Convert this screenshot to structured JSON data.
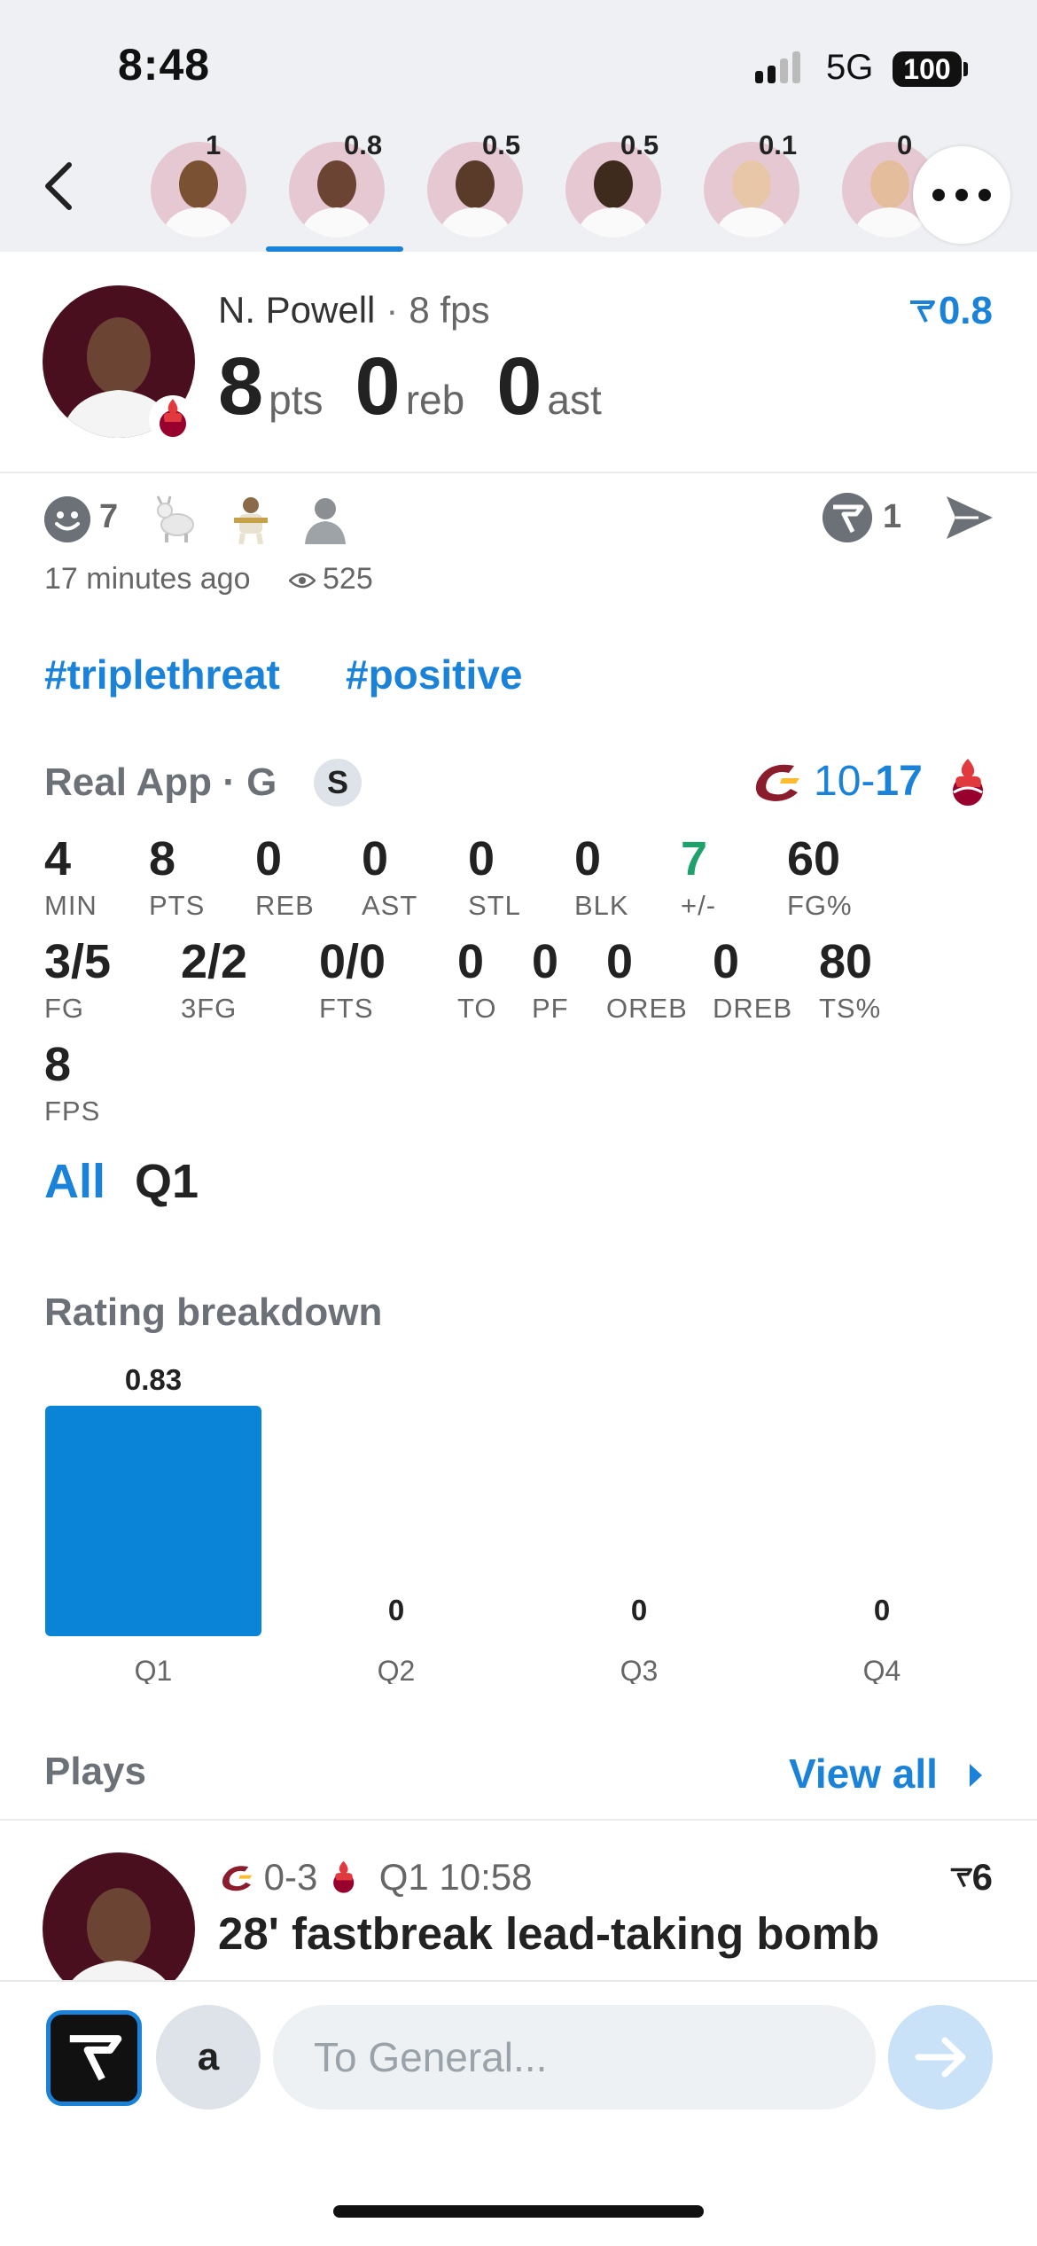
{
  "status_bar": {
    "time": "8:48",
    "network": "5G",
    "battery": "100"
  },
  "players_strip": [
    {
      "rating": "1"
    },
    {
      "rating": "0.8"
    },
    {
      "rating": "0.5"
    },
    {
      "rating": "0.5"
    },
    {
      "rating": "0.1"
    },
    {
      "rating": "0"
    }
  ],
  "player": {
    "name": "N. Powell",
    "fps": "8 fps",
    "rating": "0.8",
    "pts": "8",
    "pts_unit": "pts",
    "reb": "0",
    "reb_unit": "reb",
    "ast": "0",
    "ast_unit": "ast"
  },
  "reactions": {
    "count": "7",
    "v_count": "1",
    "time_ago": "17 minutes ago",
    "views": "525"
  },
  "hashtags": [
    "#triplethreat",
    "#positive"
  ],
  "game": {
    "app_line": "Real App · G",
    "badge": "S",
    "score_away": "10",
    "score_dash": "-",
    "score_home": "17",
    "colors": {
      "cavs": "#8b1c2c",
      "heat": "#98002e",
      "accent": "#1a82d8",
      "positive": "#20a06a"
    }
  },
  "stats_row1": [
    {
      "value": "4",
      "label": "MIN"
    },
    {
      "value": "8",
      "label": "PTS"
    },
    {
      "value": "0",
      "label": "REB"
    },
    {
      "value": "0",
      "label": "AST"
    },
    {
      "value": "0",
      "label": "STL"
    },
    {
      "value": "0",
      "label": "BLK"
    },
    {
      "value": "7",
      "label": "+/-"
    },
    {
      "value": "60",
      "label": "FG%"
    }
  ],
  "stats_row2": [
    {
      "value": "3/5",
      "label": "FG"
    },
    {
      "value": "2/2",
      "label": "3FG"
    },
    {
      "value": "0/0",
      "label": "FTS"
    },
    {
      "value": "0",
      "label": "TO"
    },
    {
      "value": "0",
      "label": "PF"
    },
    {
      "value": "0",
      "label": "OREB"
    },
    {
      "value": "0",
      "label": "DREB"
    },
    {
      "value": "80",
      "label": "TS%"
    }
  ],
  "stats_row3": [
    {
      "value": "8",
      "label": "FPS"
    }
  ],
  "filters": {
    "all": "All",
    "q1": "Q1"
  },
  "rating_breakdown": {
    "title": "Rating breakdown"
  },
  "chart_data": {
    "type": "bar",
    "categories": [
      "Q1",
      "Q2",
      "Q3",
      "Q4"
    ],
    "values": [
      0.83,
      0,
      0,
      0
    ],
    "value_labels": [
      "0.83",
      "0",
      "0",
      "0"
    ],
    "title": "Rating breakdown",
    "color": "#0a84d6"
  },
  "plays": {
    "title": "Plays",
    "view_all": "View all",
    "item": {
      "score": "0-3",
      "time": "Q1 10:58",
      "rating": "6",
      "title": "28' fastbreak lead-taking bomb"
    }
  },
  "composer": {
    "user_initial": "a",
    "placeholder": "To General..."
  }
}
